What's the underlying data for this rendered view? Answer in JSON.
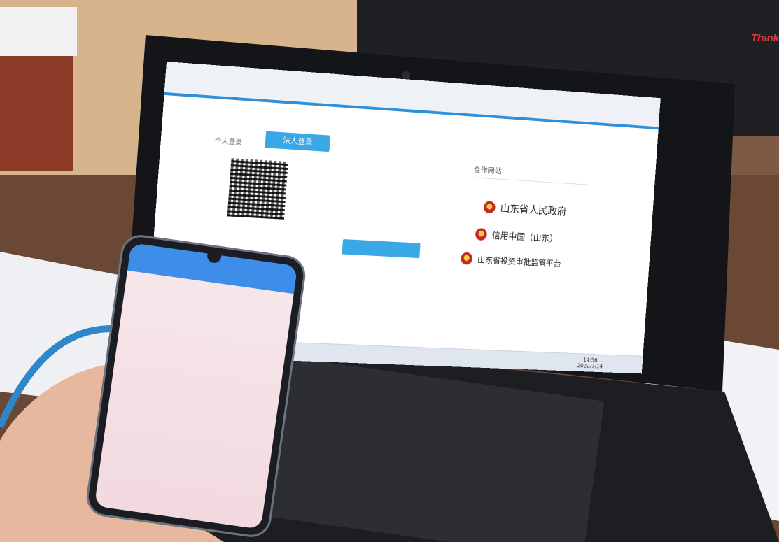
{
  "screen": {
    "tabs": {
      "personal": "个人登录",
      "legal": "法人登录"
    },
    "partners": {
      "title": "合作网站",
      "items": [
        "山东省人民政府",
        "信用中国（山东）",
        "山东省投资审批监管平台"
      ]
    },
    "taskbar": {
      "time": "14:56",
      "date": "2022/7/14"
    }
  },
  "laptop": {
    "brand": "Think"
  },
  "colors": {
    "accent": "#3aa7e6",
    "phone_header": "#3c8ee8"
  }
}
